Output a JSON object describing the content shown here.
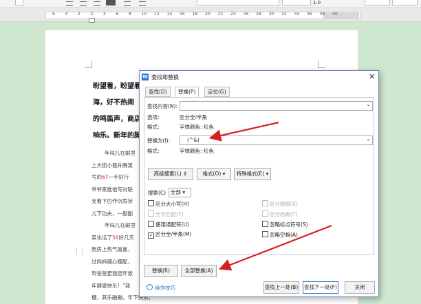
{
  "toolbar": {
    "zoom_value": "1.0",
    "ruler_ticks": [
      "6",
      "4",
      "2",
      "2",
      "4",
      "6",
      "8",
      "10",
      "12",
      "14",
      "16",
      "18",
      "20",
      "22",
      "24",
      "26",
      "28",
      "30",
      "32",
      "34",
      "36",
      "38",
      "40"
    ]
  },
  "document": {
    "heading_lines": [
      "盼望着，盼望着",
      "海，好不热闹",
      "的鸣笛声，商店",
      "响乐。新年的脚"
    ],
    "body_lines": [
      {
        "pre": "年味儿在邮里",
        "red": "",
        "post": ""
      },
      {
        "pre": "上大街小巷升腾莱",
        "red": "",
        "post": ""
      },
      {
        "pre": "写的",
        "red": "67",
        "post": "一手好行"
      },
      {
        "pre": "爷爷家推他写对联",
        "red": "",
        "post": ""
      },
      {
        "pre": "支着下巴作沉思状",
        "red": "",
        "post": ""
      },
      {
        "pre": "儿下功夫，一副副",
        "red": "",
        "post": ""
      },
      {
        "pre": "年味儿在邮里",
        "red": "",
        "post": ""
      },
      {
        "pre": "菜化话了",
        "red": "56",
        "post": "好几天"
      },
      {
        "pre": "厨房上热气氤氲，",
        "red": "",
        "post": ""
      },
      {
        "pre": "过妈妈细心摆配，",
        "red": "",
        "post": ""
      },
      {
        "pre": "到爸爸更我团年饭",
        "red": "",
        "post": ""
      },
      {
        "pre": "年健康快乐！”我",
        "red": "",
        "post": ""
      },
      {
        "pre": "棚，其乐融融，年下快乐。",
        "red": "",
        "post": ""
      }
    ]
  },
  "dialog": {
    "logo": "W",
    "title": "查找和替换",
    "close": "✕",
    "tabs": [
      "查找(D)",
      "替换(P)",
      "定位(G)"
    ],
    "find_label": "查找内容(N):",
    "find_value": "",
    "find_options_label": "选项:",
    "find_options_value": "区分全/半角",
    "find_format_label": "格式:",
    "find_format_value": "字体颜色: 红色",
    "replace_label": "替换为(I):",
    "replace_value": "(^&)",
    "replace_format_label": "格式:",
    "replace_format_value": "字体颜色: 红色",
    "advanced_button": "高级搜索(L) ⇕",
    "format_button": "格式(O) ▾",
    "special_button": "特殊格式(E) ▾",
    "search_label": "搜索(C)",
    "search_value": "全部",
    "options_left": [
      {
        "label": "区分大小写(H)",
        "checked": false,
        "disabled": false
      },
      {
        "label": "全字匹配(Y)",
        "checked": false,
        "disabled": true
      },
      {
        "label": "使用通配符(U)",
        "checked": false,
        "disabled": false
      },
      {
        "label": "区分全/半角(M)",
        "checked": true,
        "disabled": false
      }
    ],
    "options_right": [
      {
        "label": "区分前缀(X)",
        "checked": false,
        "disabled": true
      },
      {
        "label": "区分后缀(T)",
        "checked": false,
        "disabled": true
      },
      {
        "label": "忽略标点符号(S)",
        "checked": false,
        "disabled": false
      },
      {
        "label": "忽略空格(A)",
        "checked": false,
        "disabled": false
      }
    ],
    "replace_button": "替换(R)",
    "replace_all_button": "全部替换(A)",
    "tips_link": "操作技巧",
    "find_prev_button": "查找上一处(B)",
    "find_next_button": "查找下一处(F)",
    "close_button": "关闭"
  },
  "colors": {
    "arrow": "#d42020",
    "accent": "#2f6fd8",
    "doc_red": "#d33333"
  }
}
